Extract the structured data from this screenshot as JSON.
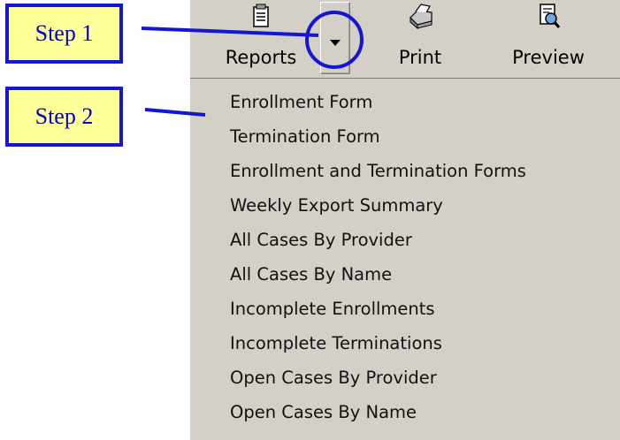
{
  "toolbar": {
    "reports_label": "Reports",
    "print_label": "Print",
    "preview_label": "Preview"
  },
  "menu": {
    "items": [
      "Enrollment Form",
      "Termination Form",
      "Enrollment and Termination Forms",
      "Weekly Export Summary",
      "All Cases By Provider",
      "All Cases By Name",
      "Incomplete Enrollments",
      "Incomplete Terminations",
      "Open Cases By Provider",
      "Open Cases By Name"
    ]
  },
  "callouts": {
    "step1": "Step 1",
    "step2": "Step 2"
  },
  "colors": {
    "chrome": "#d4d0c8",
    "callout_fill": "#ffff99",
    "callout_border": "#1515d4",
    "callout_text": "#0000cc"
  },
  "icons": {
    "reports": "report-document-icon",
    "print": "printer-icon",
    "preview": "print-preview-icon",
    "dropdown": "chevron-down-icon"
  }
}
